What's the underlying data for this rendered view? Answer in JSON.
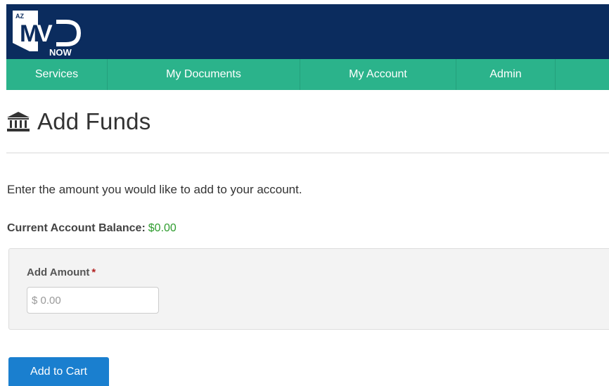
{
  "branding": {
    "logo_state": "AZ",
    "logo_main": "MVD",
    "logo_sub": "NOW",
    "header_color": "#0b2c5e",
    "nav_color": "#2bb38b"
  },
  "nav": {
    "items": [
      {
        "label": "Services"
      },
      {
        "label": "My Documents"
      },
      {
        "label": "My Account"
      },
      {
        "label": "Admin"
      }
    ]
  },
  "page": {
    "icon": "bank-icon",
    "title": "Add Funds",
    "instructions": "Enter the amount you would like to add to your account.",
    "balance_label": "Current Account Balance:",
    "balance_value": "$0.00",
    "balance_color": "#2e9c2e"
  },
  "form": {
    "amount_label": "Add Amount",
    "required_marker": "*",
    "amount_placeholder": "$ 0.00",
    "amount_value": ""
  },
  "actions": {
    "add_to_cart_label": "Add to Cart",
    "button_color": "#1a7fcf"
  }
}
